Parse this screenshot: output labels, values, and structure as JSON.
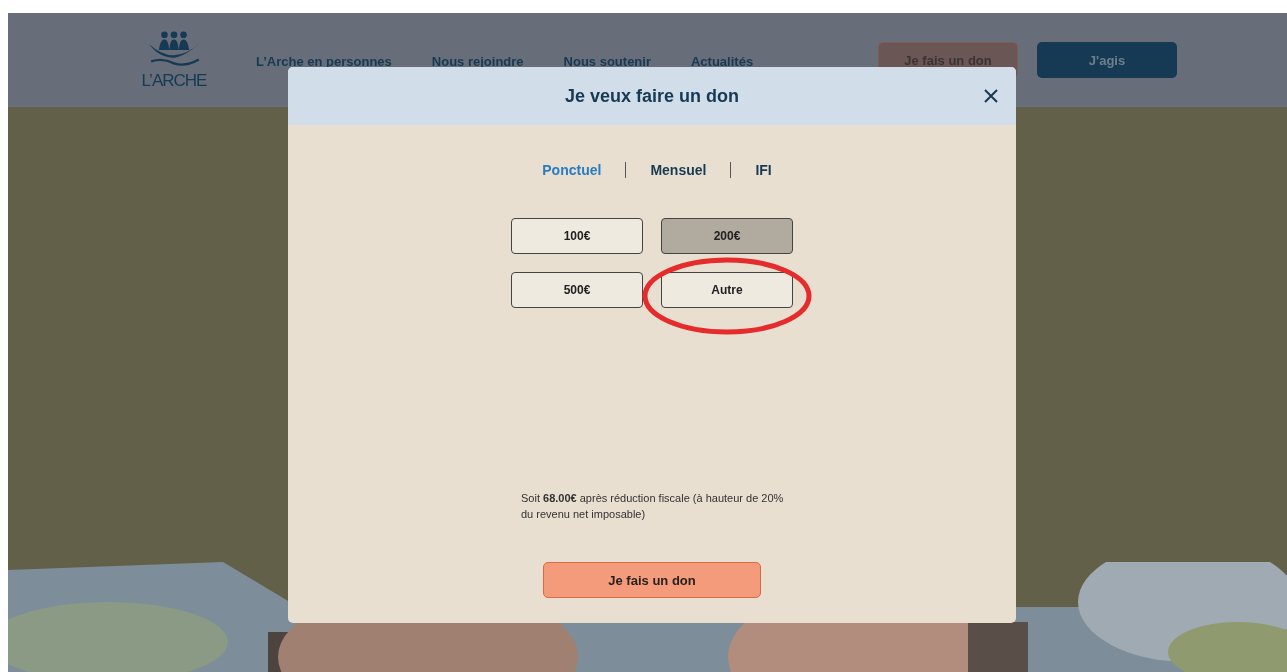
{
  "site": {
    "logo_text": "L’ARCHE",
    "nav": [
      "L’Arche en personnes",
      "Nous rejoindre",
      "Nous soutenir",
      "Actualités"
    ],
    "donate_button": "Je fais un don",
    "act_button": "J'agis"
  },
  "modal": {
    "title": "Je veux faire un don",
    "tabs": [
      {
        "label": "Ponctuel",
        "selected": true
      },
      {
        "label": "Mensuel",
        "selected": false
      },
      {
        "label": "IFI",
        "selected": false
      }
    ],
    "amounts": [
      {
        "label": "100€",
        "selected": false
      },
      {
        "label": "200€",
        "selected": true
      },
      {
        "label": "500€",
        "selected": false
      },
      {
        "label": "Autre",
        "selected": false
      }
    ],
    "tax_note": "Soit **68.00€** après réduction fiscale (à hauteur de 20% du revenu net imposable)",
    "submit": "Je fais un don"
  }
}
